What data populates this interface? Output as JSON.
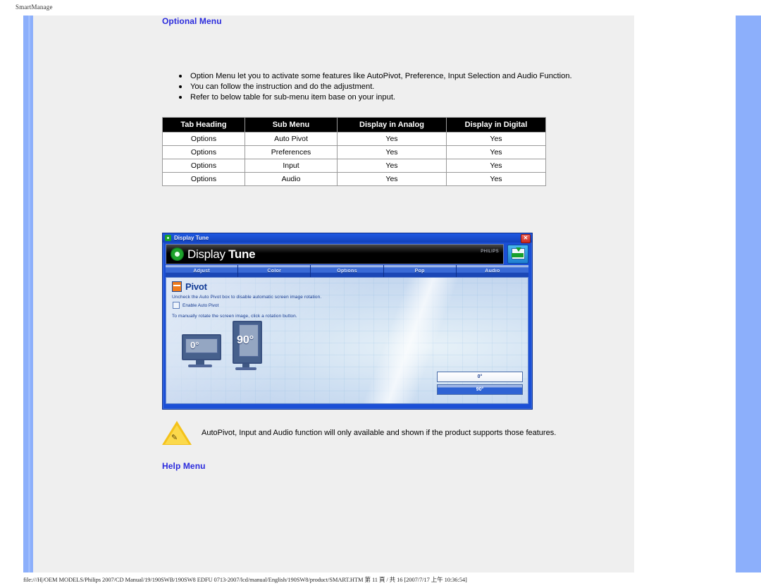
{
  "page": {
    "top_label": "SmartManage",
    "footer": "file:///H|/OEM MODELS/Philips 2007/CD Manual/19/190SWB/190SW8 EDFU 0713-2007/lcd/manual/English/190SW8/product/SMART.HTM 第 11 頁 / 共 16 [2007/7/17 上午 10:36:54]"
  },
  "sections": {
    "optional_menu_heading": "Optional Menu",
    "help_menu_heading": "Help Menu"
  },
  "bullets": [
    "Option Menu let you to activate some features like AutoPivot, Preference, Input Selection and Audio Function.",
    "You can follow the instruction and do the adjustment.",
    "Refer to below table for sub-menu item base on your input."
  ],
  "table": {
    "headers": [
      "Tab Heading",
      "Sub Menu",
      "Display in Analog",
      "Display in Digital"
    ],
    "rows": [
      [
        "Options",
        "Auto Pivot",
        "Yes",
        "Yes"
      ],
      [
        "Options",
        "Preferences",
        "Yes",
        "Yes"
      ],
      [
        "Options",
        "Input",
        "Yes",
        "Yes"
      ],
      [
        "Options",
        "Audio",
        "Yes",
        "Yes"
      ]
    ]
  },
  "dialog": {
    "titlebar_text": "Display Tune",
    "close_label": "✕",
    "banner_word1": "Display ",
    "banner_word2": "Tune",
    "brand_name": "PHILIPS",
    "tabs": [
      {
        "label": "Adjust"
      },
      {
        "label": "Color"
      },
      {
        "label": "Options"
      },
      {
        "label": "Pop"
      },
      {
        "label": "Audio"
      }
    ],
    "panel": {
      "title": "Pivot",
      "description": "Uncheck the Auto Pivot box to disable automatic screen image rotation.",
      "checkbox_label": "Enable Auto Pivot",
      "manual_text": "To manually rotate the screen image, click a rotation button.",
      "monitor_landscape_label": "0°",
      "monitor_portrait_label": "90°",
      "button_0": "0°",
      "button_90": "90°"
    }
  },
  "note": {
    "text": "AutoPivot, Input and Audio function will only available and shown if the product supports those features."
  },
  "colors": {
    "heading_blue": "#2b2bdd",
    "dialog_blue": "#1b4fd6",
    "page_gray": "#efefef",
    "rail_blue": "#8caffb",
    "warning_yellow": "#f4c21a"
  }
}
